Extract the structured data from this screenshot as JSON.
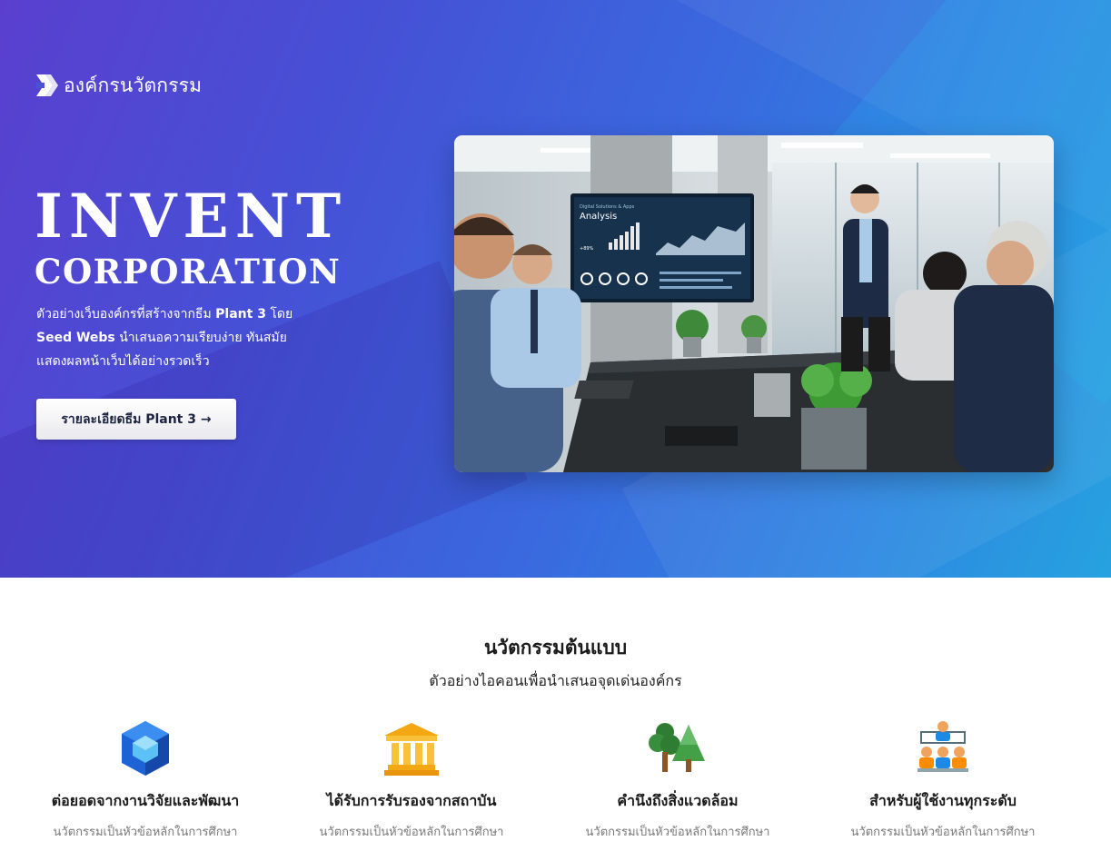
{
  "brand": {
    "name": "องค์กรนวัตกรรม",
    "icon": "logo-arrow-icon"
  },
  "hero": {
    "title_line1": "INVENT",
    "title_line2": "CORPORATION",
    "desc_part1": "ตัวอย่างเว็บองค์กรที่สร้างจากธีม ",
    "desc_strong1": "Plant 3",
    "desc_part2": " โดย",
    "desc_strong2": "Seed Webs",
    "desc_part3": " นำเสนอความเรียบง่าย ทันสมัย",
    "desc_line3": "แสดงผลหน้าเว็บได้อย่างรวดเร็ว",
    "cta_label": "รายละเอียดธีม Plant 3 →",
    "photo": {
      "screen_title": "Analysis",
      "screen_caption": "Digital Solutions & Apps",
      "screen_stat": "+89%"
    }
  },
  "features_section": {
    "title": "นวัตกรรมต้นแบบ",
    "subtitle": "ตัวอย่างไอคอนเพื่อนำเสนอจุดเด่นองค์กร"
  },
  "features": [
    {
      "icon": "cube-icon",
      "title": "ต่อยอดจากงานวิจัยและพัฒนา",
      "desc": "นวัตกรรมเป็นหัวข้อหลักในการศึกษา"
    },
    {
      "icon": "institution-icon",
      "title": "ได้รับการรับรองจากสถาบัน",
      "desc": "นวัตกรรมเป็นหัวข้อหลักในการศึกษา"
    },
    {
      "icon": "trees-icon",
      "title": "คำนึงถึงสิ่งแวดล้อม",
      "desc": "นวัตกรรมเป็นหัวข้อหลักในการศึกษา"
    },
    {
      "icon": "team-hierarchy-icon",
      "title": "สำหรับผู้ใช้งานทุกระดับ",
      "desc": "นวัตกรรมเป็นหัวข้อหลักในการศึกษา"
    }
  ],
  "colors": {
    "hero_start": "#5a3fcf",
    "hero_end": "#27a2df",
    "heading": "#1a1a1a",
    "muted": "#7a7a7a"
  }
}
